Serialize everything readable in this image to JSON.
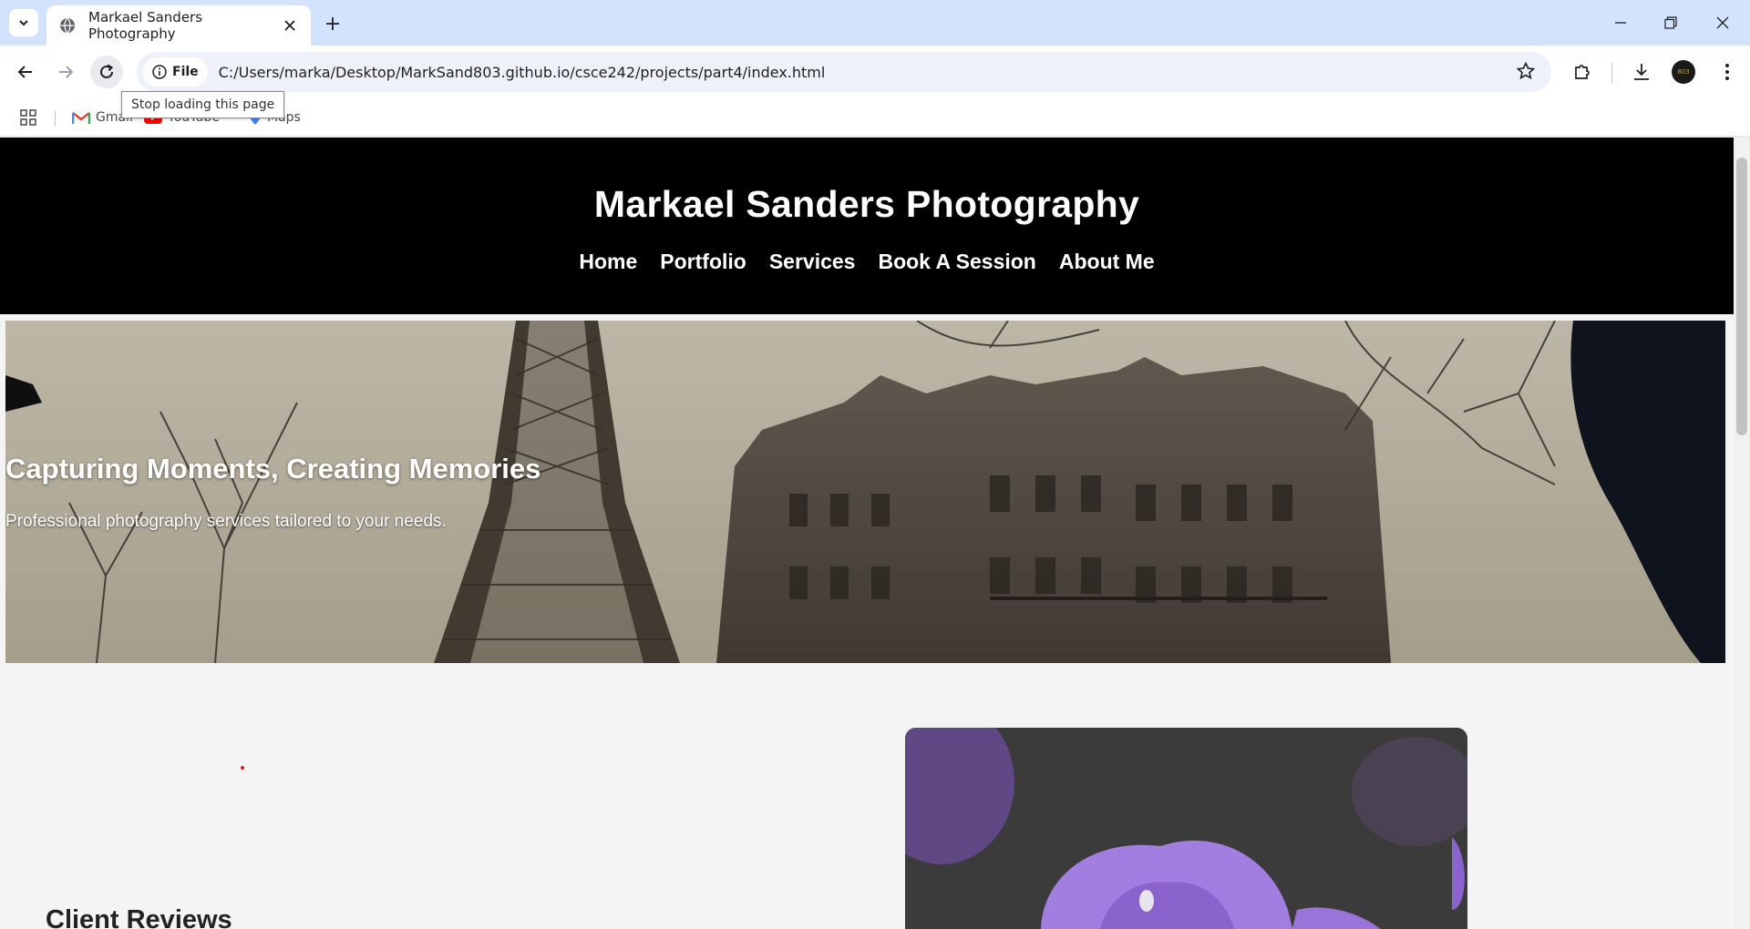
{
  "browser": {
    "tab_title": "Markael Sanders Photography",
    "chip_label": "File",
    "url": "C:/Users/marka/Desktop/MarkSand803.github.io/csce242/projects/part4/index.html",
    "tooltip": "Stop loading this page",
    "profile_initials": "803",
    "bookmarks": [
      "Gmail",
      "YouTube",
      "Maps"
    ]
  },
  "site": {
    "title": "Markael Sanders Photography",
    "nav": [
      "Home",
      "Portfolio",
      "Services",
      "Book A Session",
      "About Me"
    ],
    "hero_title": "Capturing Moments, Creating Memories",
    "hero_subtitle": "Professional photography services tailored to your needs.",
    "reviews_heading": "Client Reviews"
  },
  "colors": {
    "tabstrip": "#d3e3fd",
    "header_bg": "#000000",
    "page_bg": "#f4f4f4",
    "accent_dot": "#d4231f"
  }
}
